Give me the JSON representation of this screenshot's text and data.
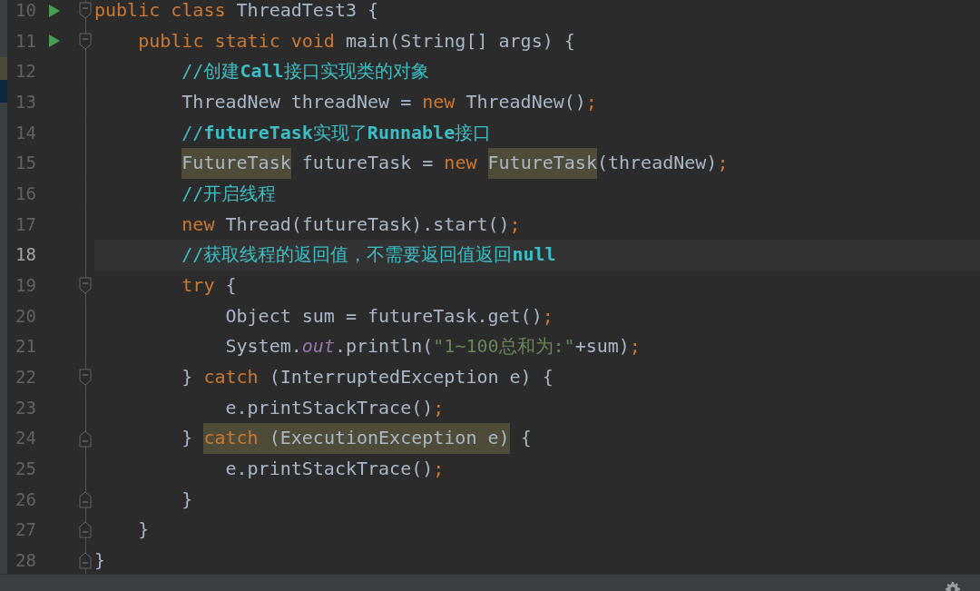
{
  "editor": {
    "lines": [
      {
        "number": "10",
        "run": true,
        "fold_open": true,
        "fold_close": false,
        "current": false,
        "tokens": [
          {
            "text": "public class ",
            "kind": "keyword"
          },
          {
            "text": "ThreadTest3 {",
            "kind": "plain"
          }
        ]
      },
      {
        "number": "11",
        "run": true,
        "fold_open": true,
        "fold_close": false,
        "current": false,
        "tokens": [
          {
            "text": "    public static void ",
            "kind": "keyword"
          },
          {
            "text": "main(String[] args) {",
            "kind": "plain"
          }
        ]
      },
      {
        "number": "12",
        "run": false,
        "fold_open": false,
        "fold_close": false,
        "current": false,
        "tokens": [
          {
            "text": "        //创建**Call**接口实现类的对象",
            "kind": "comment"
          }
        ]
      },
      {
        "number": "13",
        "run": false,
        "fold_open": false,
        "fold_close": false,
        "current": false,
        "tokens": [
          {
            "text": "        ThreadNew threadNew = ",
            "kind": "plain"
          },
          {
            "text": "new ",
            "kind": "keyword"
          },
          {
            "text": "ThreadNew()",
            "kind": "plain"
          },
          {
            "text": ";",
            "kind": "keyword"
          }
        ]
      },
      {
        "number": "14",
        "run": false,
        "fold_open": false,
        "fold_close": false,
        "current": false,
        "tokens": [
          {
            "text": "        //**futureTask**实现了**Runnable**接口",
            "kind": "comment"
          }
        ]
      },
      {
        "number": "15",
        "run": false,
        "fold_open": false,
        "fold_close": false,
        "current": false,
        "tokens": [
          {
            "text": "        FutureTask",
            "kind": "plain",
            "highlighted": true
          },
          {
            "text": " futureTask = ",
            "kind": "plain",
            "highlighted": false
          },
          {
            "text": "new ",
            "kind": "keyword",
            "highlighted": false
          },
          {
            "text": "FutureTask",
            "kind": "plain",
            "highlighted": true
          },
          {
            "text": "(threadNew)",
            "kind": "plain",
            "highlighted": false
          },
          {
            "text": ";",
            "kind": "keyword",
            "highlighted": false
          }
        ]
      },
      {
        "number": "16",
        "run": false,
        "fold_open": false,
        "fold_close": false,
        "current": false,
        "tokens": [
          {
            "text": "        //开启线程",
            "kind": "comment"
          }
        ]
      },
      {
        "number": "17",
        "run": false,
        "fold_open": false,
        "fold_close": false,
        "current": false,
        "tokens": [
          {
            "text": "        new ",
            "kind": "keyword"
          },
          {
            "text": "Thread(futureTask).start()",
            "kind": "plain"
          },
          {
            "text": ";",
            "kind": "keyword"
          }
        ]
      },
      {
        "number": "18",
        "run": false,
        "fold_open": false,
        "fold_close": false,
        "current": true,
        "tokens": [
          {
            "text": "        //获取线程的返回值，不需要返回值返回**null**",
            "kind": "comment"
          }
        ]
      },
      {
        "number": "19",
        "run": false,
        "fold_open": true,
        "fold_close": false,
        "current": false,
        "tokens": [
          {
            "text": "        try ",
            "kind": "keyword"
          },
          {
            "text": "{",
            "kind": "plain"
          }
        ]
      },
      {
        "number": "20",
        "run": false,
        "fold_open": false,
        "fold_close": false,
        "current": false,
        "tokens": [
          {
            "text": "            Object sum = futureTask.get()",
            "kind": "plain"
          },
          {
            "text": ";",
            "kind": "keyword"
          }
        ]
      },
      {
        "number": "21",
        "run": false,
        "fold_open": false,
        "fold_close": false,
        "current": false,
        "tokens": [
          {
            "text": "            System.",
            "kind": "plain"
          },
          {
            "text": "out",
            "kind": "field"
          },
          {
            "text": ".println(",
            "kind": "plain"
          },
          {
            "text": "\"1~100总和为:\"",
            "kind": "string"
          },
          {
            "text": "+sum)",
            "kind": "plain"
          },
          {
            "text": ";",
            "kind": "keyword"
          }
        ]
      },
      {
        "number": "22",
        "run": false,
        "fold_open": true,
        "fold_close": false,
        "current": false,
        "tokens": [
          {
            "text": "        } ",
            "kind": "plain"
          },
          {
            "text": "catch ",
            "kind": "keyword"
          },
          {
            "text": "(InterruptedException e) {",
            "kind": "plain"
          }
        ]
      },
      {
        "number": "23",
        "run": false,
        "fold_open": false,
        "fold_close": false,
        "current": false,
        "tokens": [
          {
            "text": "            e.printStackTrace()",
            "kind": "plain"
          },
          {
            "text": ";",
            "kind": "keyword"
          }
        ]
      },
      {
        "number": "24",
        "run": false,
        "fold_open": false,
        "fold_close": true,
        "current": false,
        "tokens": [
          {
            "text": "        } ",
            "kind": "plain",
            "highlighted": false
          },
          {
            "text": "catch ",
            "kind": "keyword",
            "highlighted": true
          },
          {
            "text": "(ExecutionException e)",
            "kind": "plain",
            "highlighted": true
          },
          {
            "text": " {",
            "kind": "plain",
            "highlighted": false
          }
        ]
      },
      {
        "number": "25",
        "run": false,
        "fold_open": false,
        "fold_close": false,
        "current": false,
        "tokens": [
          {
            "text": "            e.printStackTrace()",
            "kind": "plain"
          },
          {
            "text": ";",
            "kind": "keyword"
          }
        ]
      },
      {
        "number": "26",
        "run": false,
        "fold_open": false,
        "fold_close": true,
        "current": false,
        "tokens": [
          {
            "text": "        }",
            "kind": "plain"
          }
        ]
      },
      {
        "number": "27",
        "run": false,
        "fold_open": false,
        "fold_close": true,
        "current": false,
        "tokens": [
          {
            "text": "    }",
            "kind": "plain"
          }
        ]
      },
      {
        "number": "28",
        "run": false,
        "fold_open": false,
        "fold_close": true,
        "current": false,
        "tokens": [
          {
            "text": "}",
            "kind": "plain"
          }
        ]
      }
    ]
  }
}
